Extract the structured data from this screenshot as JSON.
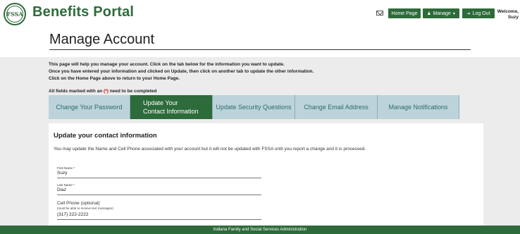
{
  "header": {
    "brand": "Benefits Portal",
    "logo_text": "FSSA",
    "home_label": "Home Page",
    "manage_label": "Manage",
    "logout_label": "Log Out",
    "welcome_line1": "Welcome,",
    "welcome_line2": "Suzy"
  },
  "page": {
    "title": "Manage Account",
    "instructions": [
      "This page will help you manage your account. Click on the tab below for the information you want to update.",
      "Once you have entered your information and clicked on Update, then click on another tab to update the other information.",
      "Click on the Home Page above to return to your Home Page."
    ],
    "required_prefix": "All fields marked with an ",
    "required_ast": "(*)",
    "required_suffix": " need to be completed"
  },
  "tabs": [
    {
      "label": "Change Your Password"
    },
    {
      "label_line1": "Update Your",
      "label_line2": "Contact Information",
      "active": true
    },
    {
      "label": "Update Security Questions"
    },
    {
      "label": "Change Email Address"
    },
    {
      "label": "Manage Notifications"
    }
  ],
  "panel": {
    "title": "Update your contact information",
    "text": "You may update the Name and Cell Phone associated with your account but it will not be updated with FSSA until you report a change and it is processed.",
    "first_name_label": "First Name *",
    "first_name_value": "Suzy",
    "last_name_label": "Last Name *",
    "last_name_value": "Diaz",
    "cell_label": "Cell Phone (optional)",
    "cell_sublabel": "(must be able to receive text messages)",
    "cell_value": "(317) 222-2222"
  },
  "footer": {
    "text": "Indiana Family and Social Services Administration"
  },
  "colors": {
    "brand_green": "#2d6b3a",
    "tab_bg": "#bcd3db",
    "tab_text": "#2d6b6b"
  },
  "icons": [
    "mail-icon",
    "user-icon",
    "caret-down-icon",
    "logout-icon"
  ]
}
